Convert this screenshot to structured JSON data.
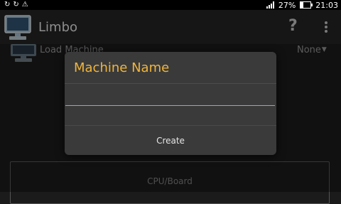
{
  "status_bar": {
    "battery_text": "27%",
    "battery_level": 0.27,
    "time": "21:03",
    "left_icons": [
      "sync-icon",
      "sync-icon",
      "warning-icon"
    ],
    "right_icons": [
      "signal-icon",
      "battery-icon"
    ]
  },
  "action_bar": {
    "app_icon": "computer-icon",
    "title": "Limbo",
    "help_label": "?",
    "overflow_icon": "overflow-menu-icon"
  },
  "load_machine": {
    "icon": "computer-icon",
    "label": "Load Machine",
    "selected": "None"
  },
  "cpu_section": {
    "label": "CPU/Board"
  },
  "dialog": {
    "title": "Machine Name",
    "input_value": "",
    "create_label": "Create"
  },
  "colors": {
    "background": "#1b1b1b",
    "dialog_bg": "#3a3a3a",
    "title_accent": "#f1b53a",
    "input_underline": "#8bc34a"
  }
}
